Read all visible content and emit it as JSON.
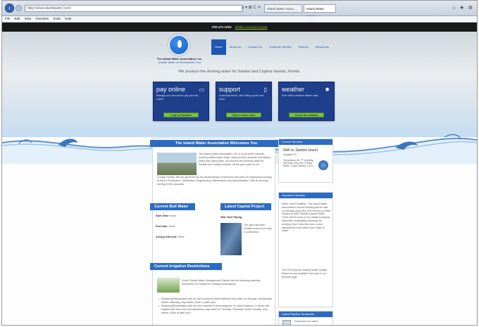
{
  "browser": {
    "url": "http://www.islandwater.com/",
    "tab1": "Island Water Assoc...",
    "tab2": "Island Water Assoc...",
    "url_icons": "ρ ▾ ⊠ C ✕",
    "chrome_icons": "⌂ ★ ⚙",
    "menu": [
      "File",
      "Edit",
      "View",
      "Favorites",
      "Tools",
      "Help"
    ]
  },
  "topstrip": {
    "phone": "239-472-1063",
    "pay_link": "Online Account Access"
  },
  "header": {
    "org_name": "The Island Water Association, Inc.",
    "tagline": "Quality Water at Reasonable Cost",
    "nav": [
      "Home",
      "About Us",
      "Contact Us",
      "Customer Service",
      "Reports",
      "Resources"
    ],
    "mission": "We produce the drinking water for Sanibel and Captiva Islands, Florida."
  },
  "boxes": {
    "pay": {
      "title": "pay online",
      "text": "Manage your account or pay your bill online.",
      "button": "Login to Register"
    },
    "support": {
      "title": "support",
      "text": "Download forms, view billing cycles and more.",
      "button": "Click to learn more"
    },
    "weather": {
      "title": "weather",
      "text": "View IWA's weather station data.",
      "button": "Check the weather"
    }
  },
  "welcome": {
    "title": "The Island Water Association Welcomes You",
    "text1": "The Island Water Association, Inc. is a not-profit, member-owned potable water utility. Using reverse osmosis and baking water from deep wells, we produce the drinking water for Sanibel and Captiva Islands, off the gulf coast of Lee",
    "text2": "County, Florida. We are governed by an elected Board of Directors and have 32 employees working at IWA in Production, Distribution, Engineering, Maintenance and Administration. IWA is currently serving 9,300 accounts."
  },
  "boil": {
    "title": "Current Boil Water",
    "start_label": "Start Date:",
    "start_value": "None",
    "end_label": "End Date:",
    "end_value": "None",
    "area_label": "Area(s) Affected:",
    "area_value": "None"
  },
  "capital": {
    "title": "Latest Capital Project",
    "project": "IWA Yard Piping",
    "text": "The pipe has been installed and is currently in production."
  },
  "irrigation": {
    "title": "Current Irrigation Restrictions",
    "text": "South Florida Water Management District has the following watering restrictions for Sanibel for existing landscaping:",
    "bullets": [
      "Residents/Businesses with an odd numbered street address may water on Monday, Wednesday, and/or Saturday, only before 10am or after 4pm.",
      "Residents/Businesses with an even numbered street address, no street address, or those that irrigate both even and odd addresses may water on Tuesday, Thursday, and/or Sunday, only before 10am or after 4pm."
    ]
  },
  "sidebar": {
    "weather": {
      "title": "Current Weather",
      "station": "IWA on Sanibel Island",
      "updated": "Updated: Fri",
      "details": "Temperature: 80.7°F  Humidity: 68%  Dew Point: 68.7°F  Wind: WNW - 5 mph  Rainfall: 0.00 in."
    },
    "updates": {
      "title": "Important Updates",
      "text": "Water Users Invitation. The Island Water Association's Annual Meeting will be held on Monday, April 14th at 10 AM at our office located at 3651 Sanibel-Captiva Road. There will be a tour of our facility to anyone interested immediately following the meeting. Don't miss this once a year opportunity to see where your water is made.",
      "text2": "The 2013 Annual Drinking Water Quality Report is now available here and on our Reports page."
    },
    "newsletter": {
      "title": "Latest Pipeline Newsletter",
      "link": "Download our Latest"
    }
  },
  "colors": {
    "nav_blue": "#1f56b5",
    "box_blue": "#1e3f8c",
    "button_green": "#7cc242",
    "bar_blue": "#2c6bc3"
  }
}
